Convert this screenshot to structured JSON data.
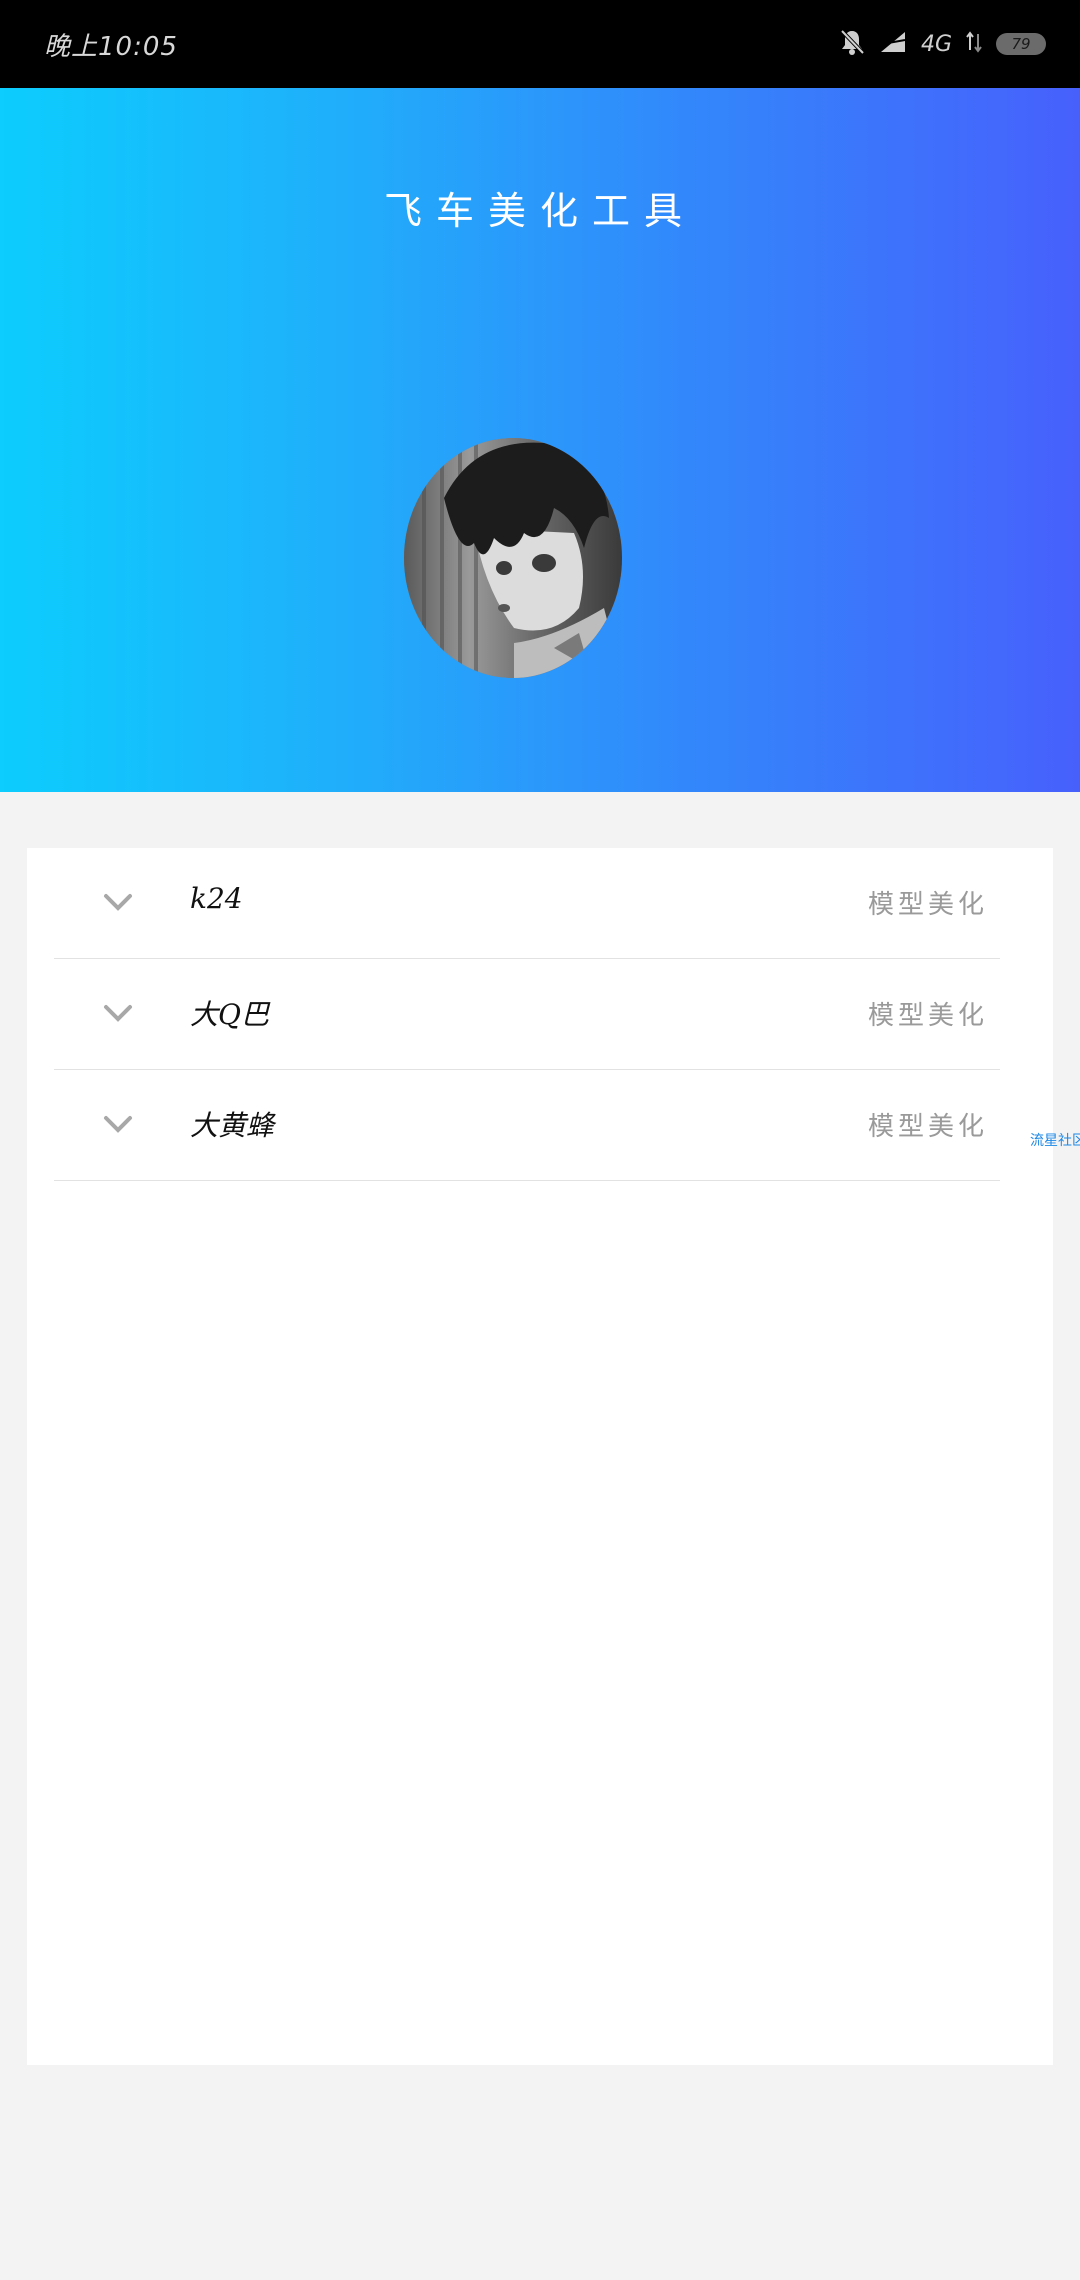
{
  "status_bar": {
    "time": "晚上10:05",
    "network": "4G",
    "battery": "79",
    "icons": [
      "bell-off-icon",
      "signal-icon",
      "data-arrows-icon",
      "battery-icon"
    ]
  },
  "header": {
    "title": "飞车美化工具",
    "gradient": [
      "#0ccdfd",
      "#4760fc"
    ]
  },
  "list": {
    "items": [
      {
        "name": "k24",
        "tag": "模型美化"
      },
      {
        "name": "大Q巴",
        "tag": "模型美化"
      },
      {
        "name": "大黄蜂",
        "tag": "模型美化"
      }
    ]
  },
  "side_link": "流星社区"
}
